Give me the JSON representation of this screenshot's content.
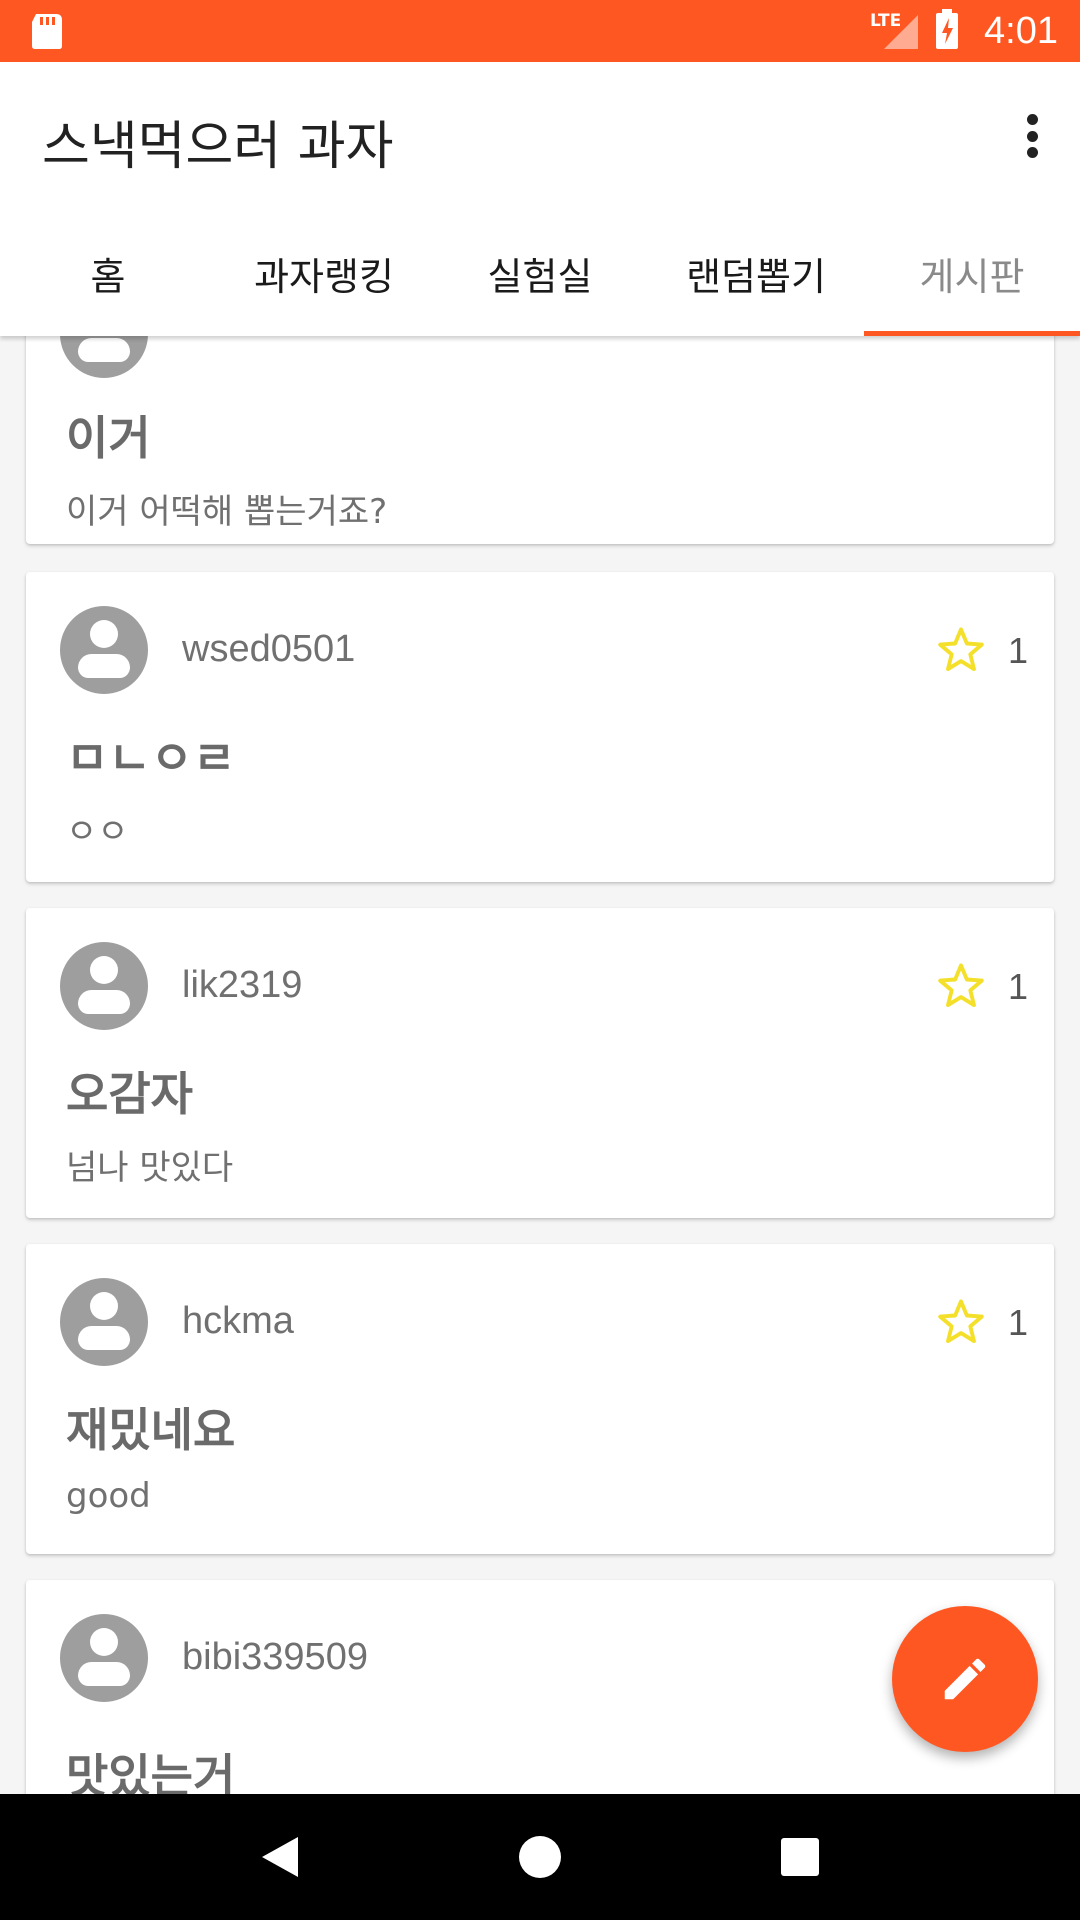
{
  "status_bar": {
    "network": "LTE",
    "time": "4:01"
  },
  "app_bar": {
    "title": "스낵먹으러 과자"
  },
  "tabs": [
    {
      "label": "홈"
    },
    {
      "label": "과자랭킹"
    },
    {
      "label": "실험실"
    },
    {
      "label": "랜덤뽑기"
    },
    {
      "label": "게시판",
      "active": true
    }
  ],
  "posts": [
    {
      "user": "",
      "title": "이거",
      "body": "이거 어떡해 뽑는거죠?",
      "likes": ""
    },
    {
      "user": "wsed0501",
      "title": "ㅁㄴㅇㄹ",
      "body": "ㅇㅇ",
      "likes": "1"
    },
    {
      "user": "lik2319",
      "title": "오감자",
      "body": "넘나 맛있다",
      "likes": "1"
    },
    {
      "user": "hckma",
      "title": "재밌네요",
      "body": "good",
      "likes": "1"
    },
    {
      "user": "bibi339509",
      "title": "맛있는거",
      "body": "",
      "likes": ""
    }
  ],
  "icons": {
    "sd_card": "sd-card-icon",
    "signal": "signal-icon",
    "battery": "battery-charging-icon",
    "overflow": "more-vert-icon",
    "avatar": "account-circle-icon",
    "star": "star-outline-icon",
    "fab": "edit-pencil-icon",
    "back": "back-triangle-icon",
    "home": "home-circle-icon",
    "recents": "recents-square-icon"
  },
  "colors": {
    "accent": "#ff5722",
    "star": "#f4e02a"
  }
}
